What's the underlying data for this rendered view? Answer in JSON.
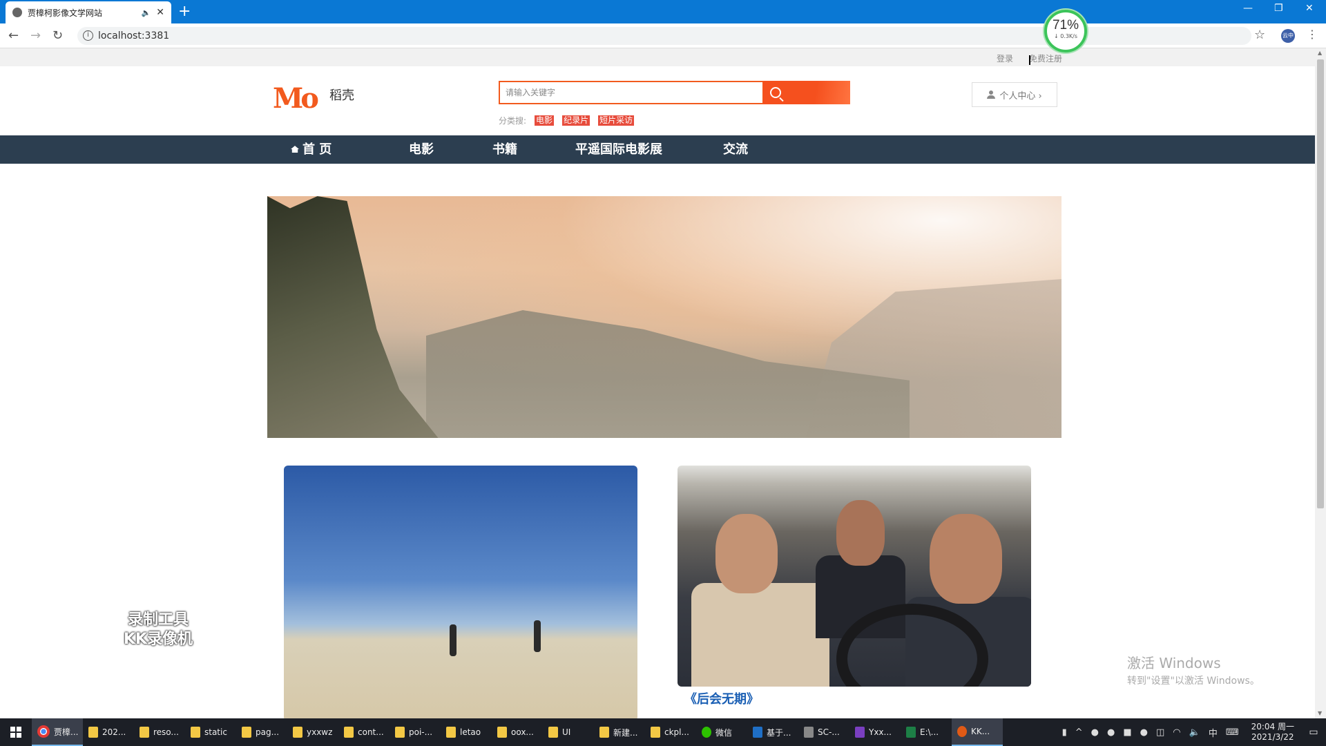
{
  "browser": {
    "tab_title": "贾樟柯影像文学网站",
    "tab_audio": "🔈",
    "tab_close": "✕",
    "new_tab": "+",
    "url": "localhost:3381",
    "speed_percent": "71%",
    "speed_rate": "↓ 0.3K/s",
    "profile_label": "云中"
  },
  "site": {
    "top_links": {
      "login": "登录",
      "register": "免费注册"
    },
    "logo_text": "稻壳",
    "logo_mark": "Mo",
    "search": {
      "placeholder": "请输入关键字"
    },
    "categories": {
      "label": "分类搜:",
      "items": [
        "电影",
        "纪录片",
        "短片采访"
      ]
    },
    "user_center": "个人中心 ›",
    "nav": [
      "首 页",
      "电影",
      "书籍",
      "平遥国际电影展",
      "交流"
    ],
    "cards": [
      {
        "caption": ""
      },
      {
        "caption": "《后会无期》"
      }
    ]
  },
  "overlays": {
    "recorder_watermark": [
      "录制工具",
      "KK录像机"
    ],
    "activate_title": "激活 Windows",
    "activate_sub": "转到\"设置\"以激活 Windows。"
  },
  "taskbar": {
    "tasks": [
      "贾樟...",
      "202...",
      "reso...",
      "static",
      "pag...",
      "yxxwz",
      "cont...",
      "poi-...",
      "letao",
      "oox...",
      "UI",
      "新建...",
      "ckpl...",
      "微信",
      "基于...",
      "SC-...",
      "Yxx...",
      "E:\\...",
      "KK..."
    ],
    "ime": "中",
    "time": "20:04 周一",
    "date": "2021/3/22"
  }
}
